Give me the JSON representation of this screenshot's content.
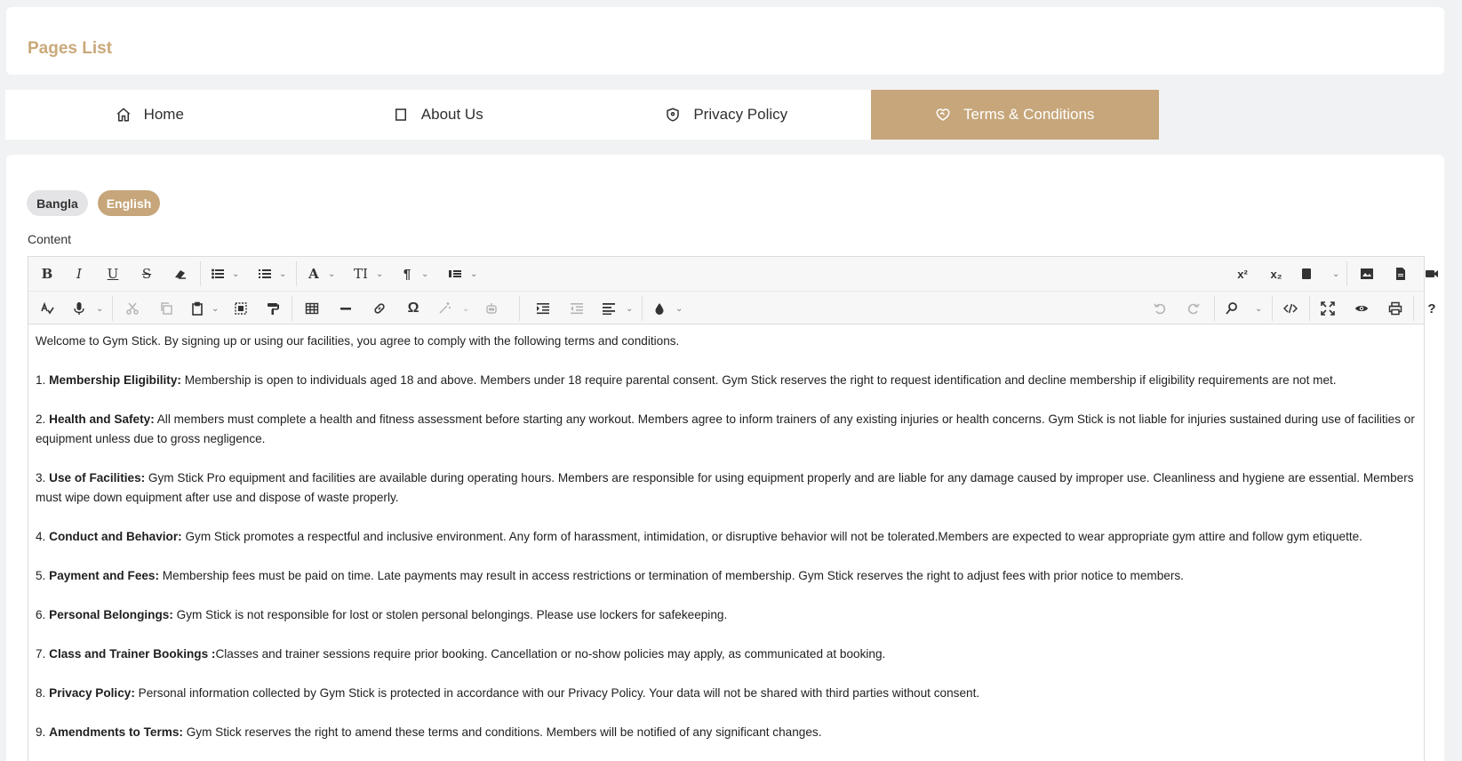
{
  "header": {
    "title": "Pages List"
  },
  "tabs": [
    {
      "label": "Home",
      "icon": "home-icon"
    },
    {
      "label": "About Us",
      "icon": "square-icon"
    },
    {
      "label": "Privacy Policy",
      "icon": "shield-icon"
    },
    {
      "label": "Terms & Conditions",
      "icon": "heart-handshake-icon",
      "active": true
    }
  ],
  "languages": {
    "bangla": "Bangla",
    "english": "English",
    "selected": "English"
  },
  "editor": {
    "label": "Content",
    "toolbar": {
      "bold": "B",
      "italic": "I",
      "underline": "U",
      "strike": "S",
      "font_color": "A",
      "font_size": "TI",
      "paragraph": "¶",
      "superscript": "x²",
      "subscript": "x₂",
      "special_char": "Ω",
      "help": "?"
    },
    "paragraphs": [
      {
        "num": "",
        "heading": "",
        "text": "Welcome to Gym Stick. By signing up or using our facilities, you agree to comply with the following terms and conditions."
      },
      {
        "num": "1. ",
        "heading": "Membership Eligibility:",
        "text": " Membership is open to individuals aged 18 and above. Members under 18 require parental consent. Gym Stick  reserves the right to request identification and decline membership if eligibility requirements are not met."
      },
      {
        "num": "2. ",
        "heading": "Health and Safety:",
        "text": " All members must complete a health and fitness assessment before starting any workout. Members agree to inform trainers of any existing injuries or health concerns. Gym Stick  is not liable for injuries sustained during use of facilities or equipment unless due to gross negligence."
      },
      {
        "num": "3. ",
        "heading": "Use of Facilities:",
        "text": " Gym Stick Pro equipment and facilities are available during operating hours. Members are responsible for using equipment properly and are liable for any damage caused by improper use. Cleanliness and hygiene are essential. Members must wipe down equipment after use and dispose of waste properly."
      },
      {
        "num": "4. ",
        "heading": "Conduct and Behavior:",
        "text": " Gym Stick promotes a respectful and inclusive environment. Any form of harassment, intimidation, or disruptive behavior will not be tolerated.Members are expected to wear appropriate gym attire and follow gym etiquette."
      },
      {
        "num": "5. ",
        "heading": "Payment and Fees:",
        "text": " Membership fees must be paid on time. Late payments may result in access restrictions or termination of membership. Gym Stick reserves the right to adjust fees with prior notice to members."
      },
      {
        "num": "6. ",
        "heading": "Personal Belongings:",
        "text": " Gym Stick is not responsible for lost or stolen personal belongings. Please use lockers for safekeeping."
      },
      {
        "num": "7. ",
        "heading": "Class and Trainer Bookings :",
        "text": "Classes and trainer sessions require prior booking. Cancellation or no-show policies may apply, as communicated at booking."
      },
      {
        "num": "8. ",
        "heading": "Privacy Policy:",
        "text": " Personal information collected by Gym Stick is protected in accordance with our Privacy Policy. Your data will not be shared with third parties without consent."
      },
      {
        "num": "9. ",
        "heading": "Amendments to Terms:",
        "text": " Gym Stick reserves the right to amend these terms and conditions. Members will be notified of any significant changes."
      }
    ]
  },
  "colors": {
    "accent": "#c6a67a",
    "title": "#c9a97a"
  }
}
